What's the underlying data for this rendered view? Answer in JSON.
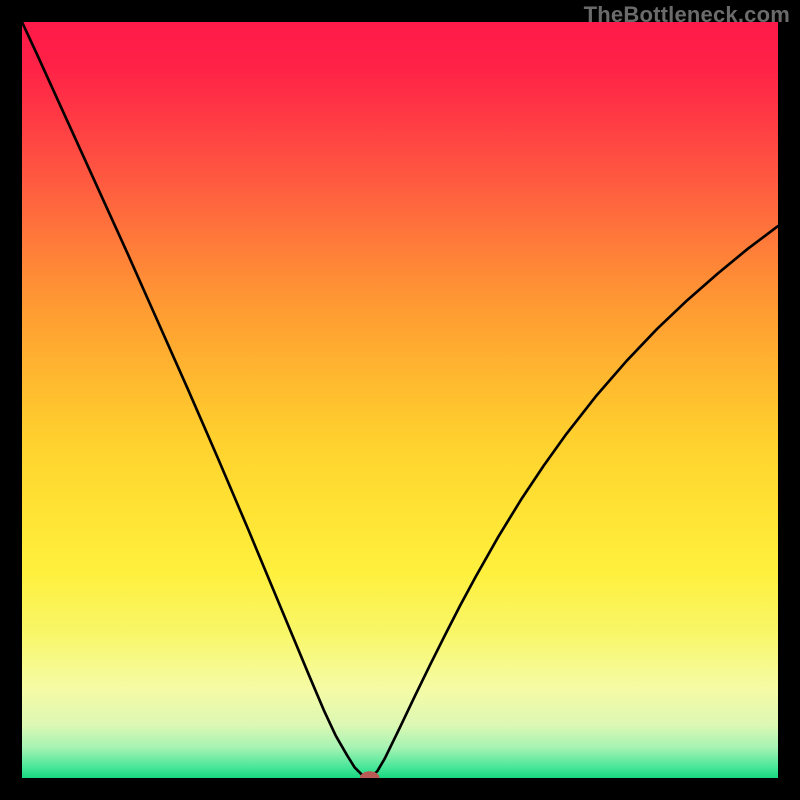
{
  "watermark": "TheBottleneck.com",
  "chart_data": {
    "type": "line",
    "title": "",
    "xlabel": "",
    "ylabel": "",
    "xlim": [
      0,
      100
    ],
    "ylim": [
      0,
      100
    ],
    "gradient_stops": [
      {
        "offset": 0.0,
        "color": "#ff1a49"
      },
      {
        "offset": 0.06,
        "color": "#ff2247"
      },
      {
        "offset": 0.13,
        "color": "#ff3b44"
      },
      {
        "offset": 0.21,
        "color": "#ff5a40"
      },
      {
        "offset": 0.29,
        "color": "#ff7a3a"
      },
      {
        "offset": 0.37,
        "color": "#ff9833"
      },
      {
        "offset": 0.46,
        "color": "#ffb52f"
      },
      {
        "offset": 0.55,
        "color": "#ffd02e"
      },
      {
        "offset": 0.64,
        "color": "#ffe233"
      },
      {
        "offset": 0.73,
        "color": "#fff03e"
      },
      {
        "offset": 0.81,
        "color": "#f8f76a"
      },
      {
        "offset": 0.88,
        "color": "#f6fba4"
      },
      {
        "offset": 0.93,
        "color": "#dcf8b4"
      },
      {
        "offset": 0.96,
        "color": "#a5f3b3"
      },
      {
        "offset": 0.985,
        "color": "#4be79a"
      },
      {
        "offset": 1.0,
        "color": "#17d880"
      }
    ],
    "series": [
      {
        "name": "bottleneck-curve",
        "x": [
          0.0,
          2.0,
          4.0,
          6.0,
          8.0,
          10.0,
          12.0,
          14.0,
          16.0,
          18.0,
          20.0,
          22.0,
          24.0,
          26.0,
          28.0,
          30.0,
          32.0,
          34.0,
          36.0,
          38.0,
          40.0,
          41.5,
          43.0,
          44.0,
          45.0,
          46.0,
          47.0,
          48.0,
          50.0,
          52.0,
          54.0,
          56.0,
          58.0,
          60.0,
          63.0,
          66.0,
          69.0,
          72.0,
          76.0,
          80.0,
          84.0,
          88.0,
          92.0,
          96.0,
          100.0
        ],
        "y": [
          100.0,
          95.7,
          91.3,
          86.9,
          82.5,
          78.1,
          73.7,
          69.3,
          64.8,
          60.3,
          55.8,
          51.3,
          46.7,
          42.1,
          37.4,
          32.7,
          27.9,
          23.1,
          18.3,
          13.5,
          8.8,
          5.6,
          3.0,
          1.4,
          0.4,
          0.0,
          0.9,
          2.6,
          6.7,
          10.9,
          15.0,
          19.0,
          22.9,
          26.6,
          31.9,
          36.8,
          41.3,
          45.5,
          50.6,
          55.2,
          59.4,
          63.2,
          66.7,
          70.0,
          73.0
        ]
      }
    ],
    "marker": {
      "x": 46.0,
      "y": 0.0,
      "color": "#b95a56",
      "rx": 1.3,
      "ry": 0.9
    }
  }
}
